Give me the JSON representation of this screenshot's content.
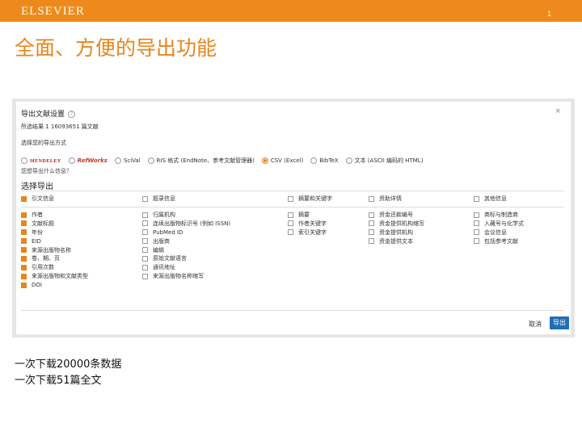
{
  "slide": {
    "brand": "ELSEVIER",
    "page_number": "1",
    "title": "全面、方便的导出功能",
    "notes": [
      "一次下载20000条数据",
      "一次下载51篇全文"
    ]
  },
  "dialog": {
    "title": "导出文献设置",
    "result_count": "所选结果 1 16093651 篇文献",
    "format_label": "选择您的导出方式",
    "formats": [
      {
        "label": "MENDELEY",
        "kind": "mendeley",
        "selected": false
      },
      {
        "label": "RefWorks",
        "kind": "refworks",
        "selected": false
      },
      {
        "label": "SciVal",
        "kind": "text",
        "selected": false
      },
      {
        "label": "RIS 格式 (EndNote、参考文献管理器)",
        "kind": "text",
        "selected": false
      },
      {
        "label": "CSV (Excel)",
        "kind": "text",
        "selected": true
      },
      {
        "label": "BibTeX",
        "kind": "text",
        "selected": false
      },
      {
        "label": "文本 (ASCII 编码的 HTML)",
        "kind": "text",
        "selected": false
      }
    ],
    "fields_hint": "您想导出什么信息？",
    "section_title": "选择导出",
    "columns": [
      {
        "header": "引文信息",
        "checked": true,
        "items": [
          {
            "label": "作者",
            "checked": true
          },
          {
            "label": "文献标题",
            "checked": true
          },
          {
            "label": "年份",
            "checked": true
          },
          {
            "label": "EID",
            "checked": true
          },
          {
            "label": "来源出版物名称",
            "checked": true
          },
          {
            "label": "卷、期、页",
            "checked": true
          },
          {
            "label": "引用次数",
            "checked": true
          },
          {
            "label": "来源出版物和文献类型",
            "checked": true
          },
          {
            "label": "DOI",
            "checked": true
          }
        ]
      },
      {
        "header": "题录信息",
        "checked": false,
        "items": [
          {
            "label": "归属机构",
            "checked": false
          },
          {
            "label": "连续出版物标识号 (例如 ISSN)",
            "checked": false
          },
          {
            "label": "PubMed ID",
            "checked": false
          },
          {
            "label": "出版商",
            "checked": false
          },
          {
            "label": "编辑",
            "checked": false
          },
          {
            "label": "原始文献语言",
            "checked": false
          },
          {
            "label": "通讯地址",
            "checked": false
          },
          {
            "label": "来源出版物名称缩写",
            "checked": false
          }
        ]
      },
      {
        "header": "摘要和关键字",
        "checked": false,
        "items": [
          {
            "label": "摘要",
            "checked": false
          },
          {
            "label": "作者关键字",
            "checked": false
          },
          {
            "label": "索引关键字",
            "checked": false
          }
        ]
      },
      {
        "header": "资助详情",
        "checked": false,
        "items": [
          {
            "label": "资金还款编号",
            "checked": false
          },
          {
            "label": "资金提供机构缩写",
            "checked": false
          },
          {
            "label": "资金提供机构",
            "checked": false
          },
          {
            "label": "资金提供文本",
            "checked": false
          }
        ]
      },
      {
        "header": "其他信息",
        "checked": false,
        "items": [
          {
            "label": "商标与制造商",
            "checked": false
          },
          {
            "label": "入藏号与化学式",
            "checked": false
          },
          {
            "label": "会议信息",
            "checked": false
          },
          {
            "label": "包括参考文献",
            "checked": false
          }
        ]
      }
    ],
    "cancel_label": "取消",
    "export_label": "导出"
  },
  "colors": {
    "brand_orange": "#ee8a1b",
    "export_blue": "#1f6fb5",
    "check_orange": "#e8861a"
  }
}
